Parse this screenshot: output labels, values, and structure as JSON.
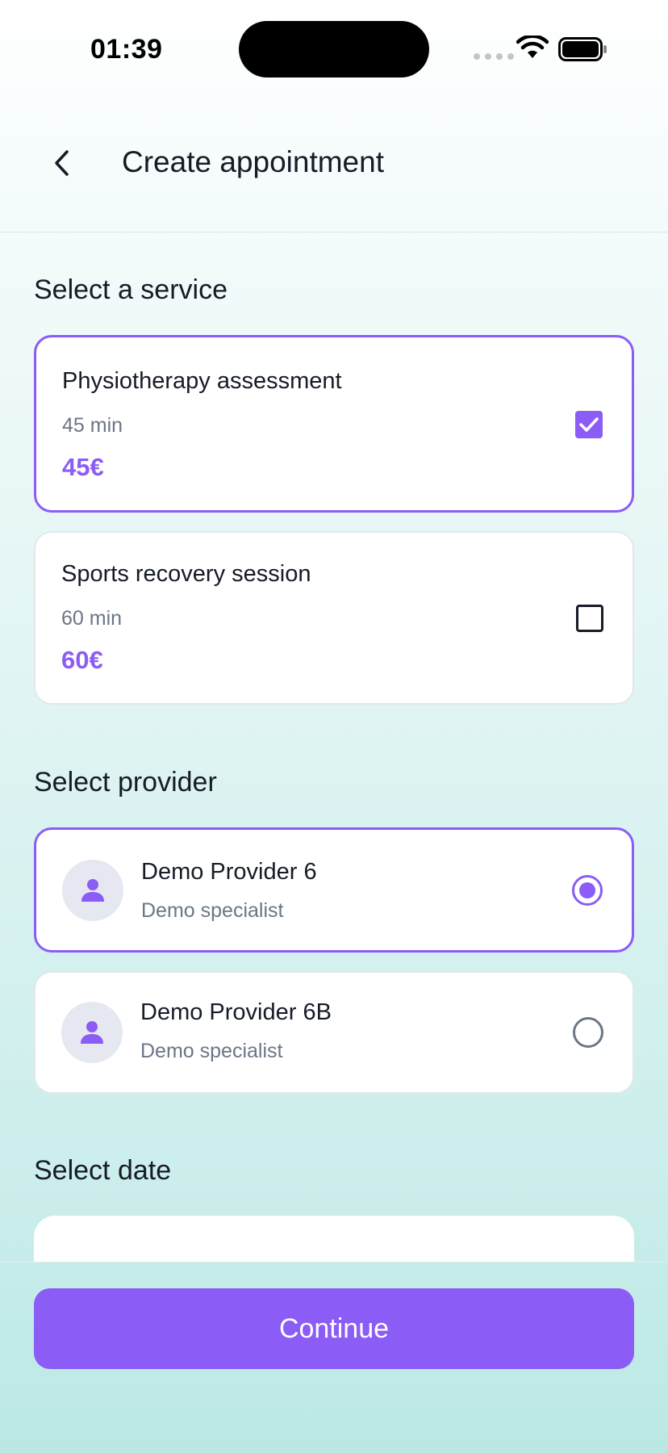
{
  "status_bar": {
    "time": "01:39"
  },
  "header": {
    "title": "Create appointment"
  },
  "services_section": {
    "title": "Select a service",
    "items": [
      {
        "name": "Physiotherapy assessment",
        "duration": "45 min",
        "price": "45€",
        "selected": true
      },
      {
        "name": "Sports recovery session",
        "duration": "60 min",
        "price": "60€",
        "selected": false
      }
    ]
  },
  "provider_section": {
    "title": "Select provider",
    "items": [
      {
        "name": "Demo Provider 6",
        "role": "Demo specialist",
        "selected": true
      },
      {
        "name": "Demo Provider 6B",
        "role": "Demo specialist",
        "selected": false
      }
    ]
  },
  "date_section": {
    "title": "Select date"
  },
  "footer": {
    "continue_label": "Continue"
  },
  "colors": {
    "accent": "#8b5cf6",
    "text": "#161b26",
    "muted": "#6b7685"
  },
  "icons": [
    "chevron-left-icon",
    "check-icon",
    "user-icon",
    "wifi-icon",
    "battery-icon"
  ]
}
